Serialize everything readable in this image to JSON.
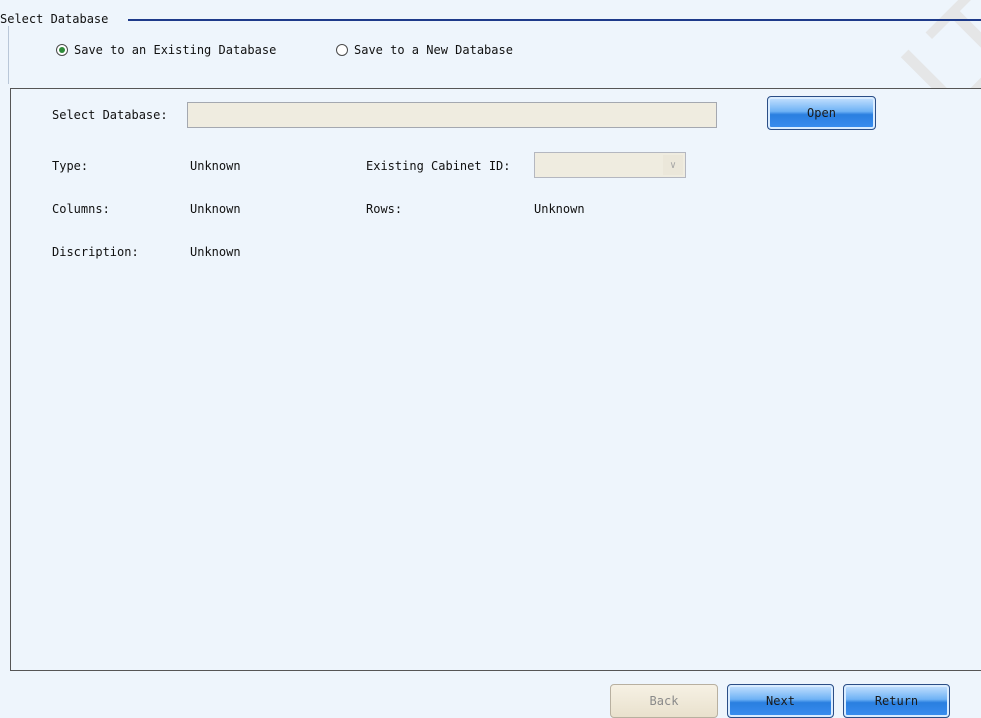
{
  "group": {
    "title": "Select Database"
  },
  "mode": {
    "existing_label": "Save to an Existing Database",
    "new_label": "Save to a New Database",
    "selected": "existing"
  },
  "form": {
    "select_db_label": "Select Database:",
    "select_db_value": "",
    "open_label": "Open",
    "type_label": "Type:",
    "type_value": "Unknown",
    "cabinet_label": "Existing Cabinet ID:",
    "cabinet_value": "",
    "columns_label": "Columns:",
    "columns_value": "Unknown",
    "rows_label": "Rows:",
    "rows_value": "Unknown",
    "desc_label": "Discription:",
    "desc_value": "Unknown"
  },
  "footer": {
    "back_label": "Back",
    "next_label": "Next",
    "return_label": "Return"
  },
  "watermark": {
    "text": "CH CO., LTD"
  }
}
